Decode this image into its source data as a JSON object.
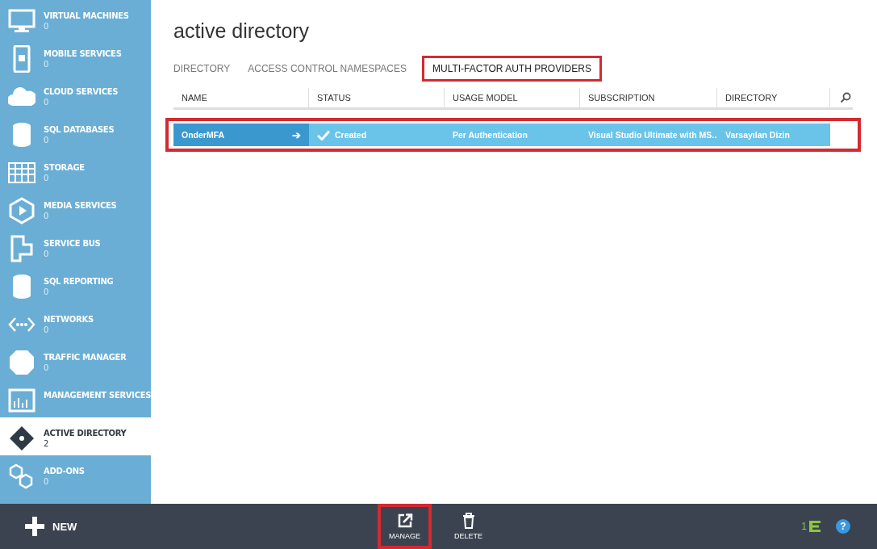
{
  "sidebar": {
    "items": [
      {
        "label": "VIRTUAL MACHINES",
        "count": "0",
        "selected": false
      },
      {
        "label": "MOBILE SERVICES",
        "count": "0",
        "selected": false
      },
      {
        "label": "CLOUD SERVICES",
        "count": "0",
        "selected": false
      },
      {
        "label": "SQL DATABASES",
        "count": "0",
        "selected": false
      },
      {
        "label": "STORAGE",
        "count": "0",
        "selected": false
      },
      {
        "label": "MEDIA SERVICES",
        "count": "0",
        "selected": false
      },
      {
        "label": "SERVICE BUS",
        "count": "0",
        "selected": false
      },
      {
        "label": "SQL REPORTING",
        "count": "0",
        "selected": false
      },
      {
        "label": "NETWORKS",
        "count": "0",
        "selected": false
      },
      {
        "label": "TRAFFIC MANAGER",
        "count": "0",
        "selected": false
      },
      {
        "label": "MANAGEMENT SERVICES",
        "selected": false
      },
      {
        "label": "ACTIVE DIRECTORY",
        "count": "2",
        "selected": true
      },
      {
        "label": "ADD-ONS",
        "count": "0",
        "selected": false
      }
    ]
  },
  "page": {
    "title": "active directory"
  },
  "tabs": [
    {
      "label": "DIRECTORY",
      "selected": false,
      "highlighted": false
    },
    {
      "label": "ACCESS CONTROL NAMESPACES",
      "selected": false,
      "highlighted": false
    },
    {
      "label": "MULTI-FACTOR AUTH PROVIDERS",
      "selected": true,
      "highlighted": true
    }
  ],
  "table": {
    "columns": [
      "NAME",
      "STATUS",
      "USAGE MODEL",
      "SUBSCRIPTION",
      "DIRECTORY"
    ],
    "rows": [
      {
        "name": "OnderMFA",
        "arrow": "➔",
        "status": "Created",
        "usage_model": "Per Authentication",
        "subscription": "Visual Studio Ultimate with MS...",
        "directory": "Varsayılan Dizin",
        "selected": true,
        "highlighted": true
      }
    ]
  },
  "command_bar": {
    "new_label": "NEW",
    "actions": [
      {
        "label": "MANAGE",
        "kind": "manage",
        "highlighted": true
      },
      {
        "label": "DELETE",
        "kind": "delete",
        "highlighted": false
      }
    ],
    "notification_count": "1",
    "help": "?"
  }
}
